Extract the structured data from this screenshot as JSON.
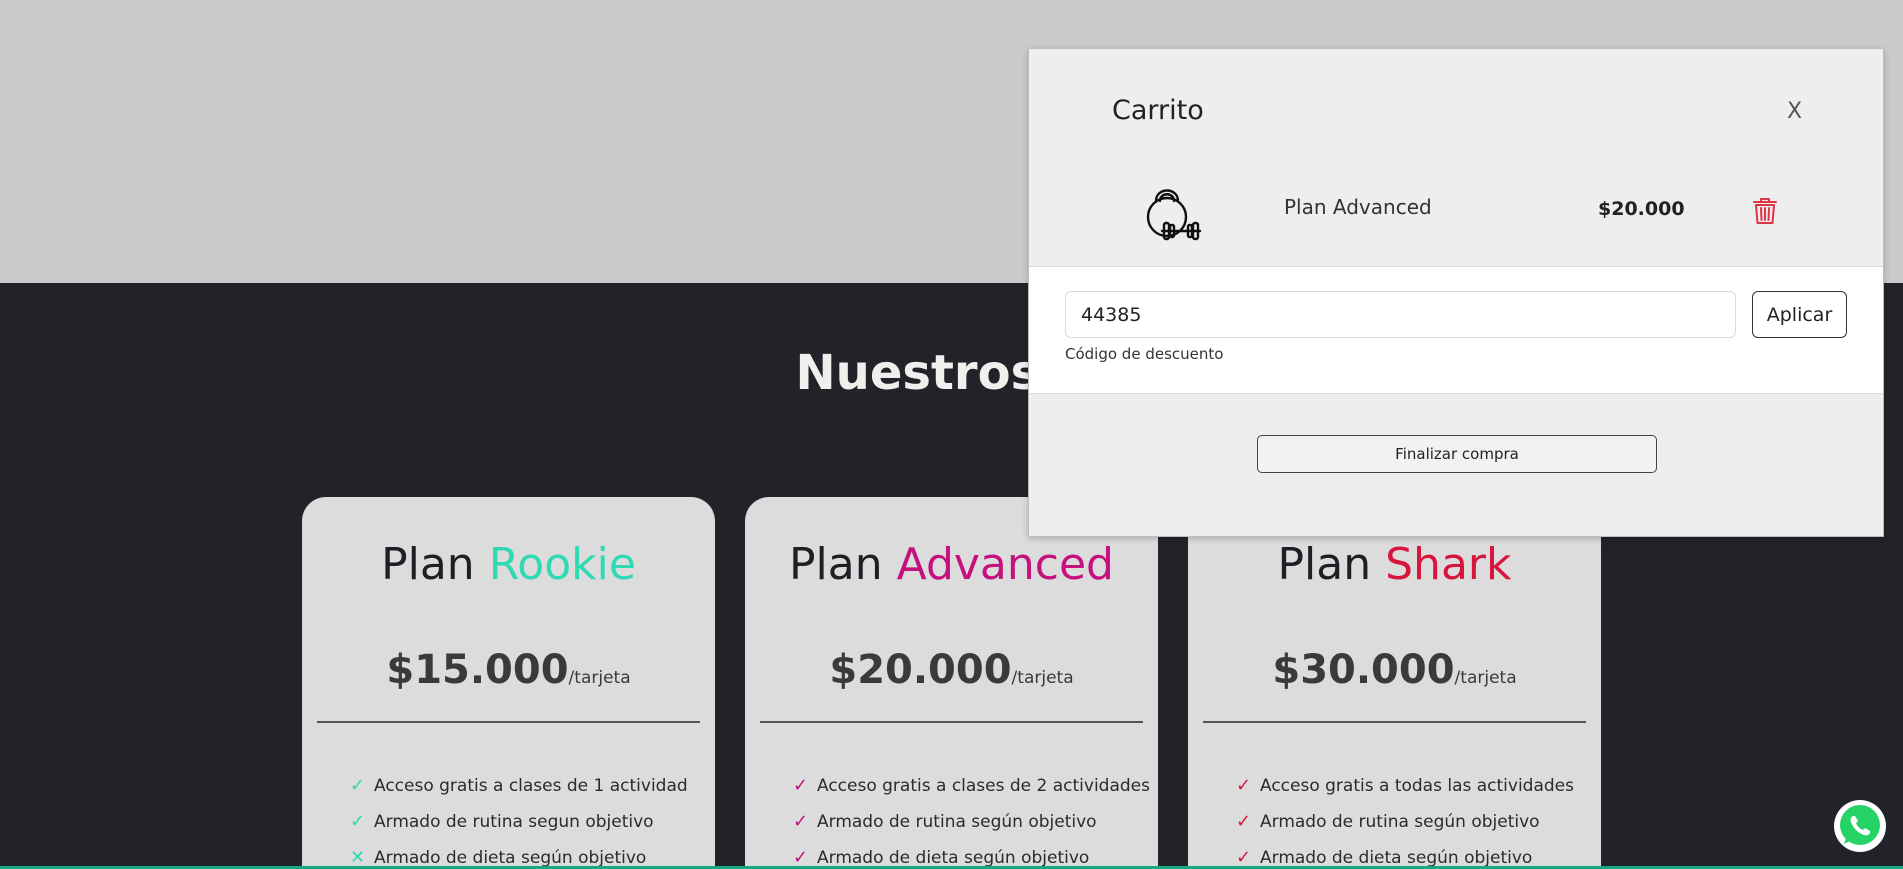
{
  "plans_section": {
    "title": "Nuestros Pl"
  },
  "plans": [
    {
      "prefix": "Plan",
      "accent_name": "Rookie",
      "accent_color": "#2fd9b1",
      "price": "$15.000",
      "unit": "/tarjeta",
      "features": [
        {
          "text": "Acceso gratis a clases de 1 actividad",
          "mark": "check"
        },
        {
          "text": "Armado de rutina segun objetivo",
          "mark": "check"
        },
        {
          "text": "Armado de dieta según objetivo",
          "mark": "cross"
        }
      ]
    },
    {
      "prefix": "Plan",
      "accent_name": "Advanced",
      "accent_color": "#c4117e",
      "price": "$20.000",
      "unit": "/tarjeta",
      "features": [
        {
          "text": "Acceso gratis a clases de 2 actividades",
          "mark": "check"
        },
        {
          "text": "Armado de rutina según objetivo",
          "mark": "check"
        },
        {
          "text": "Armado de dieta según objetivo",
          "mark": "check"
        }
      ]
    },
    {
      "prefix": "Plan",
      "accent_name": "Shark",
      "accent_color": "#d8153d",
      "price": "$30.000",
      "unit": "/tarjeta",
      "features": [
        {
          "text": "Acceso gratis a todas las actividades",
          "mark": "check"
        },
        {
          "text": "Armado de rutina según objetivo",
          "mark": "check"
        },
        {
          "text": "Armado de dieta según objetivo",
          "mark": "check"
        }
      ]
    }
  ],
  "cart": {
    "title": "Carrito",
    "close_label": "X",
    "item": {
      "icon": "kettlebell-icon",
      "name": "Plan Advanced",
      "price": "$20.000",
      "delete_icon": "trash-icon"
    },
    "discount": {
      "value": "44385",
      "label": "Código de descuento",
      "apply_label": "Aplicar"
    },
    "checkout_label": "Finalizar compra"
  },
  "floating": {
    "whatsapp_icon": "whatsapp-icon"
  }
}
